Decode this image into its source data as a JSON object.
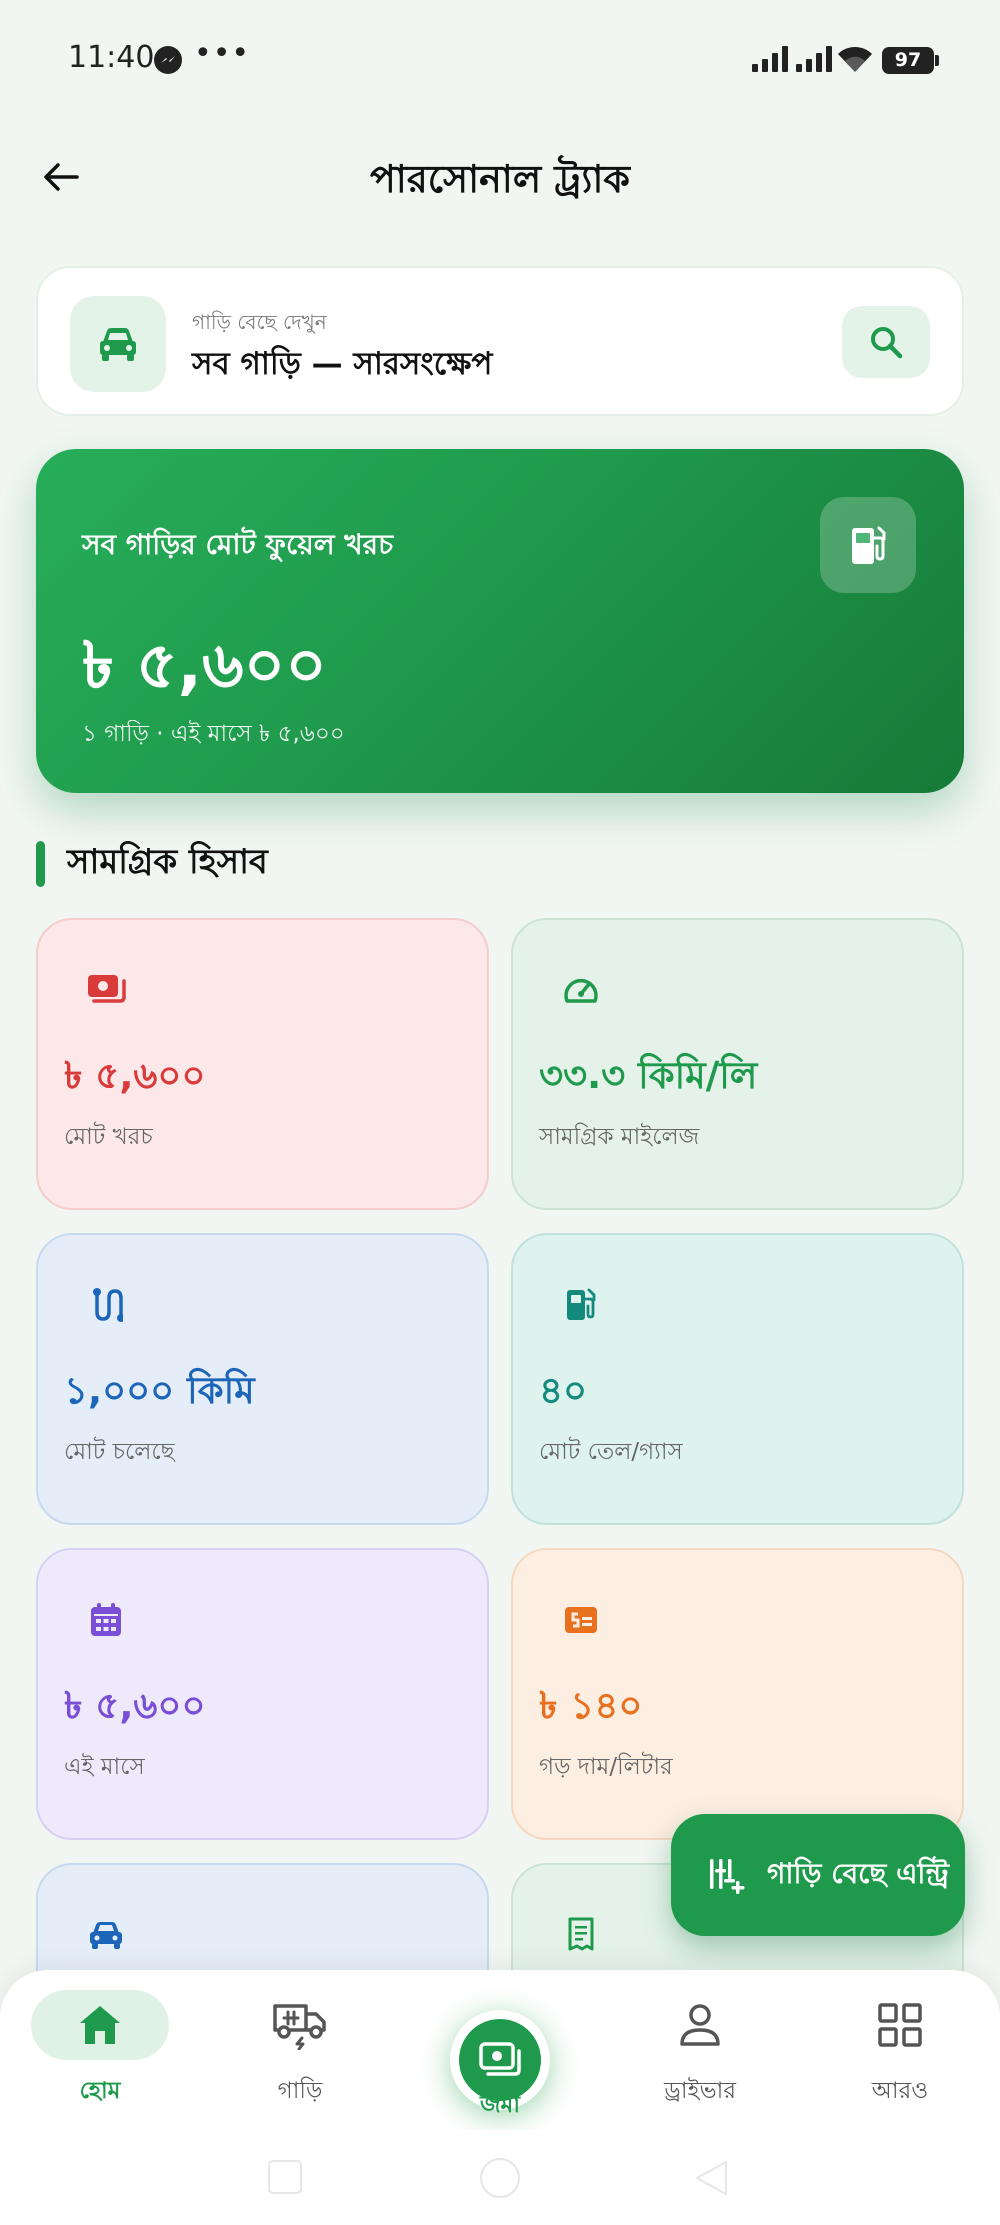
{
  "status_bar": {
    "time": "11:40",
    "dots": "•••",
    "battery": "97"
  },
  "header": {
    "title": "পারসোনাল ট্র্যাক"
  },
  "selector": {
    "subtitle": "গাড়ি বেছে দেখুন",
    "title": "সব গাড়ি — সারসংক্ষেপ"
  },
  "hero": {
    "label": "সব গাড়ির মোট ফুয়েল খরচ",
    "value": "৳ ৫,৬০০",
    "subtitle": "১ গাড়ি · এই মাসে ৳ ৫,৬০০"
  },
  "section": {
    "title": "সামগ্রিক হিসাব"
  },
  "cards": [
    {
      "value": "৳ ৫,৬০০",
      "label": "মোট খরচ",
      "icon": "money-icon",
      "color": "#d93a3a"
    },
    {
      "value": "৩৩.৩ কিমি/লি",
      "label": "সামগ্রিক মাইলেজ",
      "icon": "speedometer-icon",
      "color": "#1f9a4c"
    },
    {
      "value": "১,০০০ কিমি",
      "label": "মোট চলেছে",
      "icon": "route-icon",
      "color": "#1c65b8"
    },
    {
      "value": "৪০",
      "label": "মোট তেল/গ্যাস",
      "icon": "fuel-icon",
      "color": "#138a7c"
    },
    {
      "value": "৳ ৫,৬০০",
      "label": "এই মাসে",
      "icon": "calendar-icon",
      "color": "#7a4ed6"
    },
    {
      "value": "৳ ১৪০",
      "label": "গড় দাম/লিটার",
      "icon": "price-tag-icon",
      "color": "#e8711f"
    }
  ],
  "fab": {
    "label": "গাড়ি বেছে এন্ট্রি"
  },
  "nav": [
    {
      "label": "হোম",
      "icon": "home-icon",
      "active": true
    },
    {
      "label": "গাড়ি",
      "icon": "truck-icon"
    },
    {
      "label": "জমা",
      "icon": "deposit-icon"
    },
    {
      "label": "ড্রাইভার",
      "icon": "person-icon"
    },
    {
      "label": "আরও",
      "icon": "grid-icon"
    }
  ],
  "colors": {
    "primary": "#1f9a4c",
    "primary_light": "#e0f2e6",
    "background": "#f1f6f3"
  }
}
